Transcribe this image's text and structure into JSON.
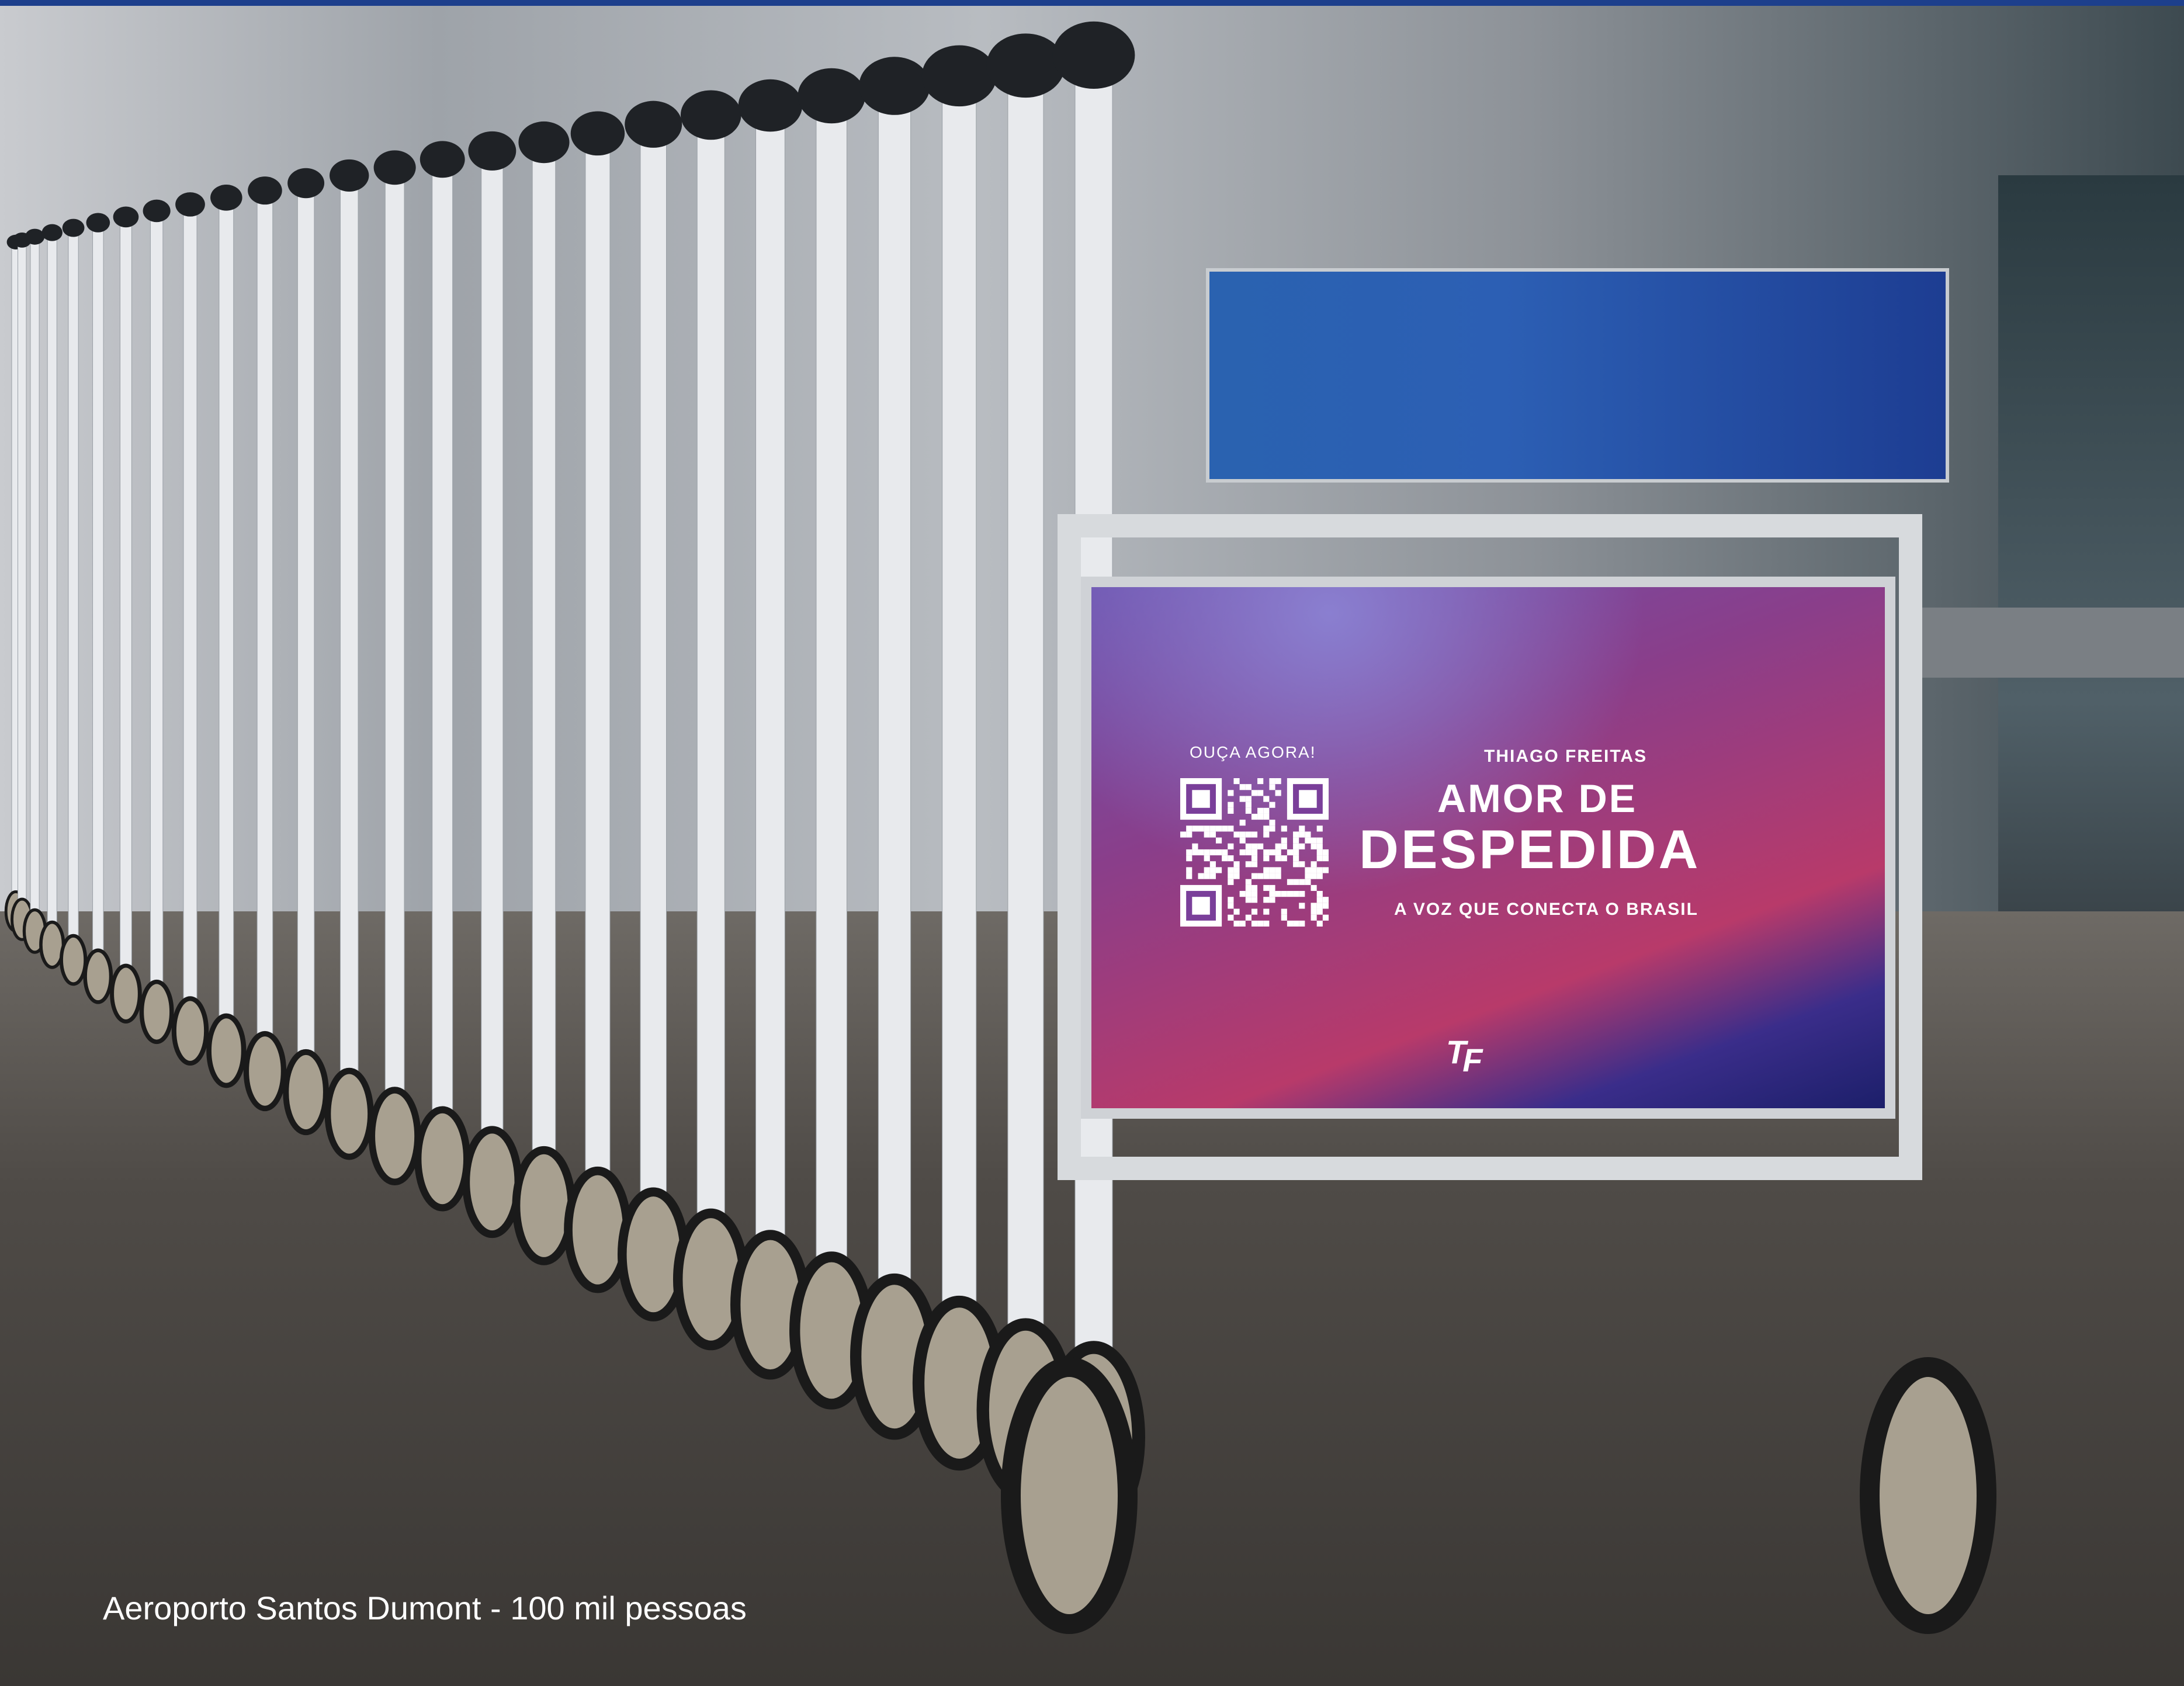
{
  "caption": "Aeroporto Santos Dumont - 100 mil pessoas",
  "ad": {
    "qr_label": "OUÇA AGORA!",
    "artist": "THIAGO FREITAS",
    "title_line1": "AMOR DE",
    "title_line2": "DESPEDIDA",
    "tagline": "A VOZ QUE CONECTA O BRASIL",
    "logo_t": "T",
    "logo_f": "F"
  },
  "icons": [
    "qr-code-icon",
    "tf-logo-icon"
  ],
  "colors": {
    "top_panel": "#2c5fb4",
    "ad_dark": "#1c1f6a",
    "ad_pink": "#b83a6a",
    "ad_purple": "#6c52ae"
  }
}
